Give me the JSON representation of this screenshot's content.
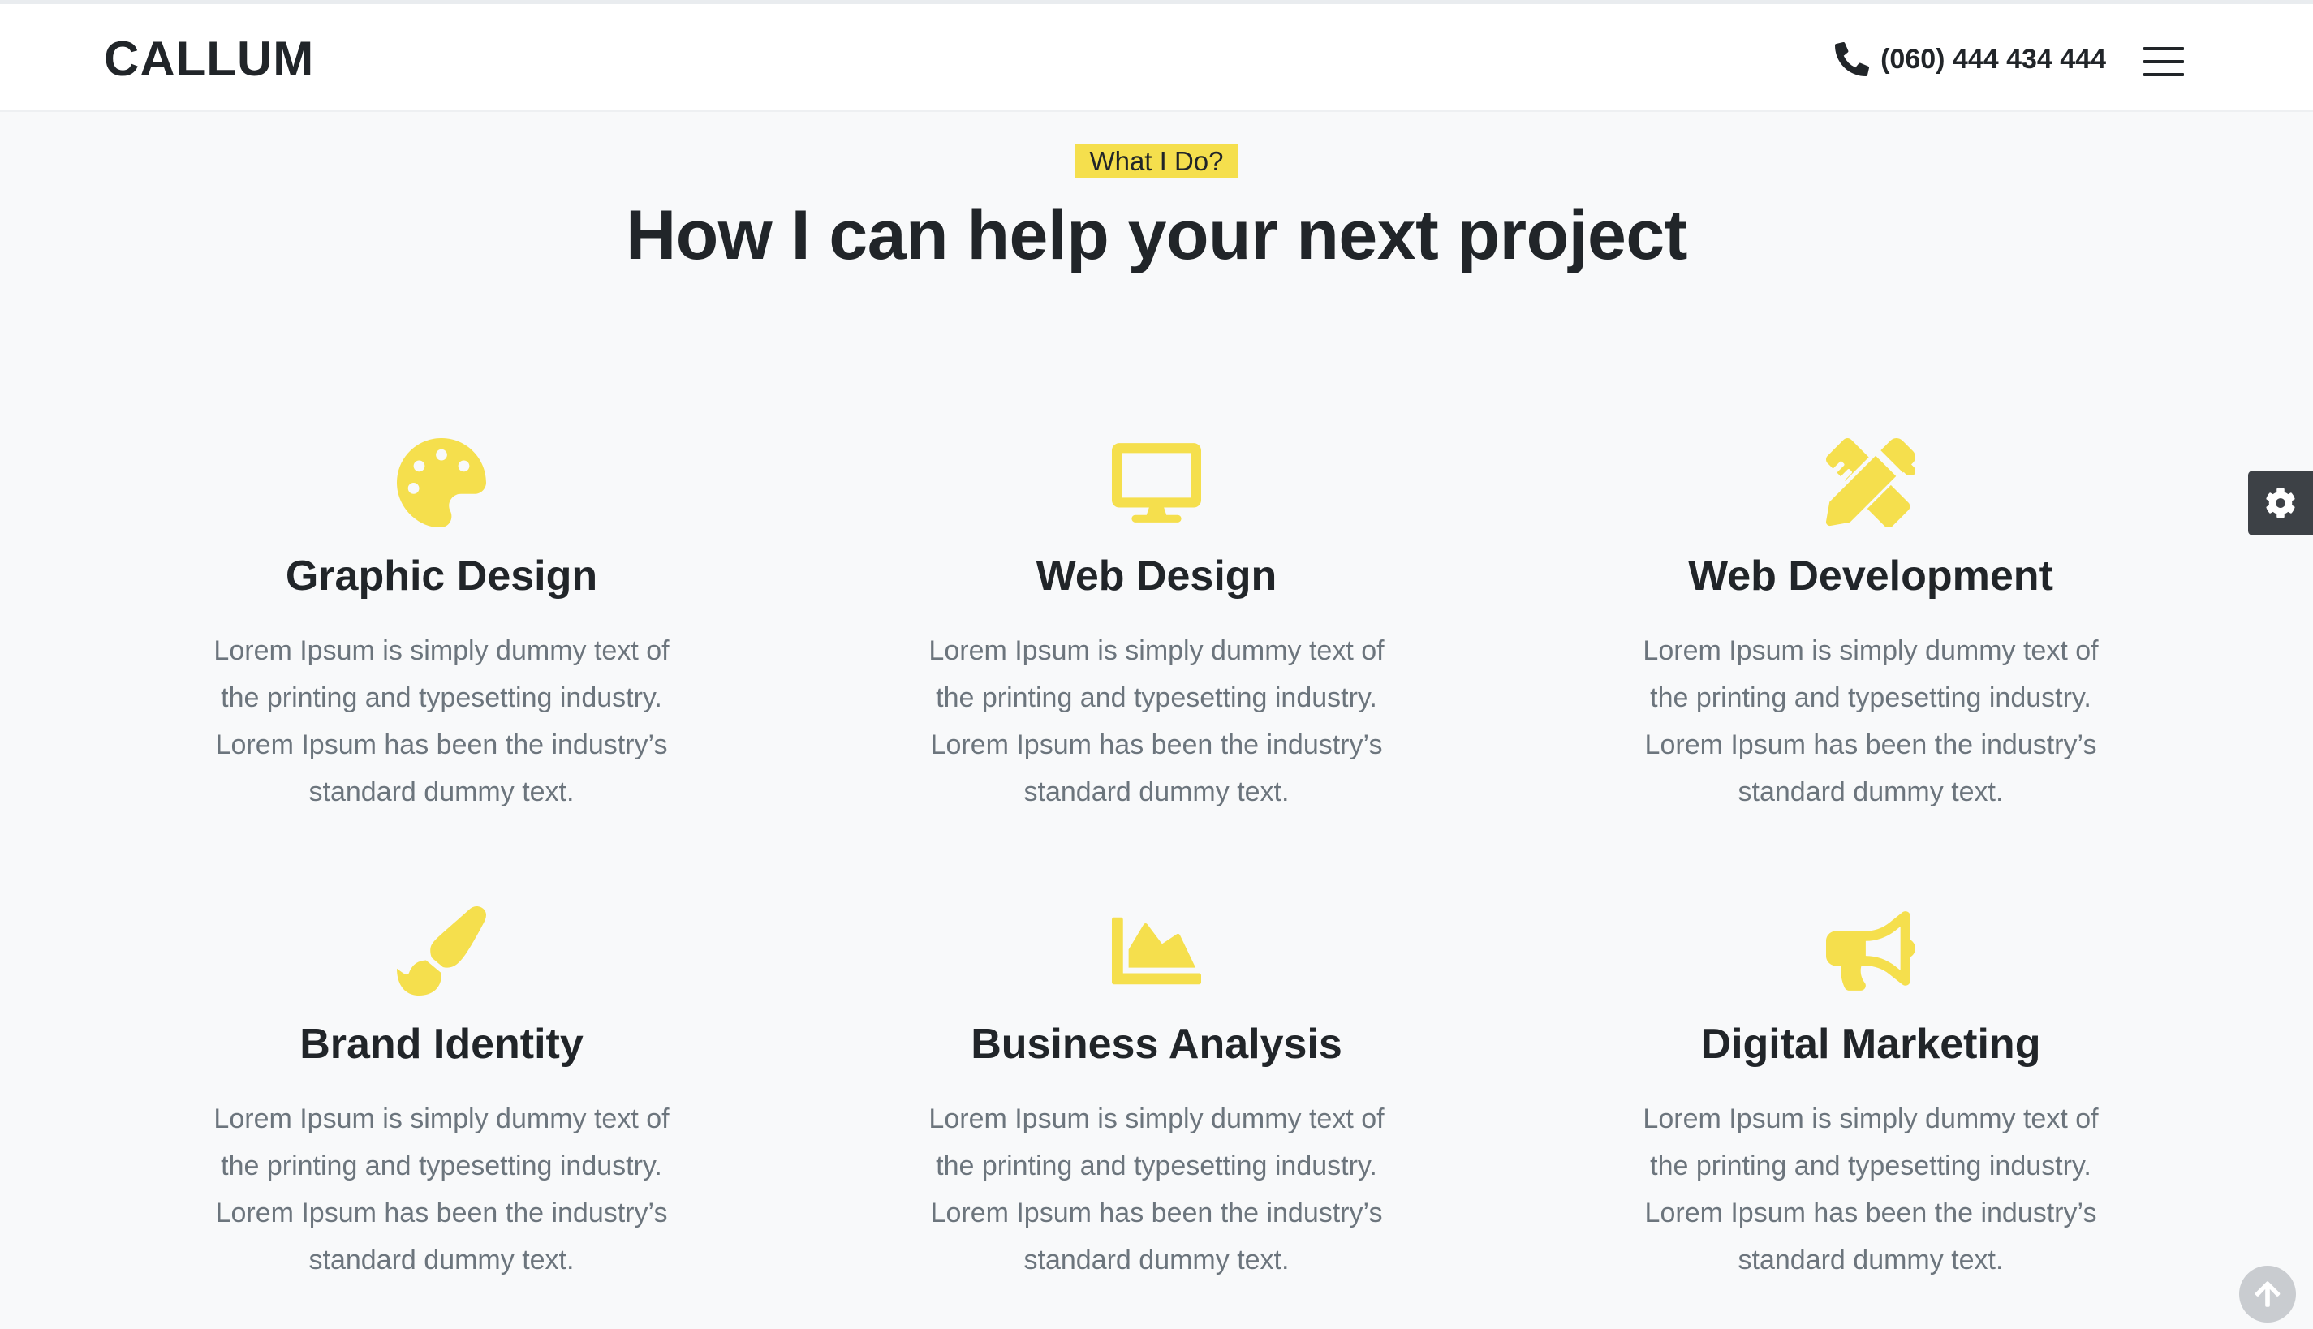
{
  "header": {
    "logo": "CALLUM",
    "phone": "(060) 444 434 444",
    "phone_icon": "phone-icon",
    "menu_icon": "hamburger-menu-icon"
  },
  "section": {
    "badge": "What I Do?",
    "title": "How I can help your next project"
  },
  "accent_color": "#f5df4d",
  "services": [
    {
      "icon": "palette-icon",
      "title": "Graphic Design",
      "text": "Lorem Ipsum is simply dummy text of the printing and typesetting industry. Lorem Ipsum has been the industry’s standard dummy text."
    },
    {
      "icon": "desktop-icon",
      "title": "Web Design",
      "text": "Lorem Ipsum is simply dummy text of the printing and typesetting industry. Lorem Ipsum has been the industry’s standard dummy text."
    },
    {
      "icon": "pencil-ruler-icon",
      "title": "Web Development",
      "text": "Lorem Ipsum is simply dummy text of the printing and typesetting industry. Lorem Ipsum has been the industry’s standard dummy text."
    },
    {
      "icon": "paint-brush-icon",
      "title": "Brand Identity",
      "text": "Lorem Ipsum is simply dummy text of the printing and typesetting industry. Lorem Ipsum has been the industry’s standard dummy text."
    },
    {
      "icon": "chart-area-icon",
      "title": "Business Analysis",
      "text": "Lorem Ipsum is simply dummy text of the printing and typesetting industry. Lorem Ipsum has been the industry’s standard dummy text."
    },
    {
      "icon": "bullhorn-icon",
      "title": "Digital Marketing",
      "text": "Lorem Ipsum is simply dummy text of the printing and typesetting industry. Lorem Ipsum has been the industry’s standard dummy text."
    }
  ],
  "widgets": {
    "settings_icon": "gear-icon",
    "scroll_top_icon": "arrow-up-icon"
  }
}
